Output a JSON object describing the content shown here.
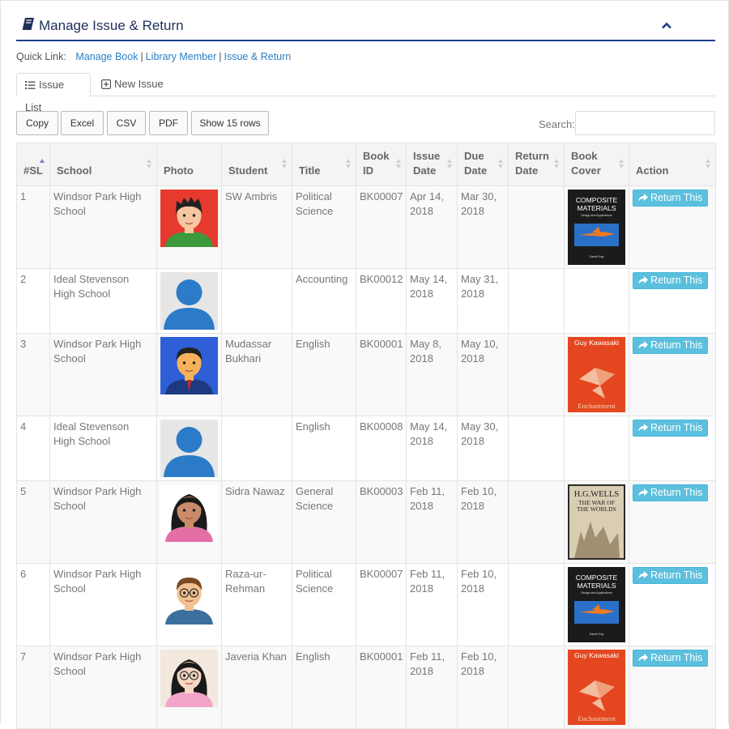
{
  "panel": {
    "title": "Manage Issue & Return"
  },
  "quick_links": {
    "label": "Quick Link:",
    "links": [
      "Manage Book",
      "Library Member",
      "Issue & Return"
    ],
    "separator": "|"
  },
  "tabs": [
    {
      "label": "Issue List",
      "active": true
    },
    {
      "label": "New Issue",
      "active": false
    }
  ],
  "toolbar": {
    "buttons": [
      "Copy",
      "Excel",
      "CSV",
      "PDF",
      "Show 15 rows"
    ]
  },
  "search": {
    "label": "Search:",
    "value": "",
    "placeholder": ""
  },
  "table": {
    "columns": [
      [
        "#SL"
      ],
      [
        "School"
      ],
      [
        "Photo"
      ],
      [
        "Student"
      ],
      [
        "Title"
      ],
      [
        "Book",
        "ID"
      ],
      [
        "Issue",
        "Date"
      ],
      [
        "Due",
        "Date"
      ],
      [
        "Return",
        "Date"
      ],
      [
        "Book",
        "Cover"
      ],
      [
        "Action"
      ]
    ],
    "action_label": "Return This",
    "rows": [
      {
        "sl": "1",
        "school": "Windsor Park High School",
        "photo": "boy-red-background",
        "student": "SW Ambris",
        "title": "Political Science",
        "book_id": "BK00007",
        "issue_date": "Apr 14, 2018",
        "due_date": "Mar 30, 2018",
        "return_date": "",
        "cover": "composite-materials"
      },
      {
        "sl": "2",
        "school": "Ideal Stevenson High School",
        "photo": "default-user",
        "student": "",
        "title": "Accounting",
        "book_id": "BK00012",
        "issue_date": "May 14, 2018",
        "due_date": "May 31, 2018",
        "return_date": "",
        "cover": ""
      },
      {
        "sl": "3",
        "school": "Windsor Park High School",
        "photo": "man-blue-background",
        "student": "Mudassar Bukhari",
        "title": "English",
        "book_id": "BK00001",
        "issue_date": "May 8, 2018",
        "due_date": "May 10, 2018",
        "return_date": "",
        "cover": "enchantment"
      },
      {
        "sl": "4",
        "school": "Ideal Stevenson High School",
        "photo": "default-user",
        "student": "",
        "title": "English",
        "book_id": "BK00008",
        "issue_date": "May 14, 2018",
        "due_date": "May 30, 2018",
        "return_date": "",
        "cover": ""
      },
      {
        "sl": "5",
        "school": "Windsor Park High School",
        "photo": "girl-dark-hair",
        "student": "Sidra Nawaz",
        "title": "General Science",
        "book_id": "BK00003",
        "issue_date": "Feb 11, 2018",
        "due_date": "Feb 10, 2018",
        "return_date": "",
        "cover": "war-of-the-worlds"
      },
      {
        "sl": "6",
        "school": "Windsor Park High School",
        "photo": "man-glasses",
        "student": "Raza-ur-Rehman",
        "title": "Political Science",
        "book_id": "BK00007",
        "issue_date": "Feb 11, 2018",
        "due_date": "Feb 10, 2018",
        "return_date": "",
        "cover": "composite-materials"
      },
      {
        "sl": "7",
        "school": "Windsor Park High School",
        "photo": "girl-glasses",
        "student": "Javeria Khan",
        "title": "English",
        "book_id": "BK00001",
        "issue_date": "Feb 11, 2018",
        "due_date": "Feb 10, 2018",
        "return_date": "",
        "cover": "enchantment"
      }
    ]
  },
  "covers": {
    "composite-materials": {
      "title_lines": [
        "COMPOSITE",
        "MATERIALS"
      ],
      "subtitle": "Design and Applications",
      "author": "Daniel Gay"
    },
    "enchantment": {
      "author": "Guy Kawasaki",
      "title": "Enchantment"
    },
    "war-of-the-worlds": {
      "author": "H.G.WELLS",
      "title_lines": [
        "THE WAR OF",
        "THE WORLDS"
      ]
    }
  },
  "colors": {
    "accent": "#1d3f8f",
    "link": "#2a7fc4",
    "info_button": "#5bc0de"
  }
}
